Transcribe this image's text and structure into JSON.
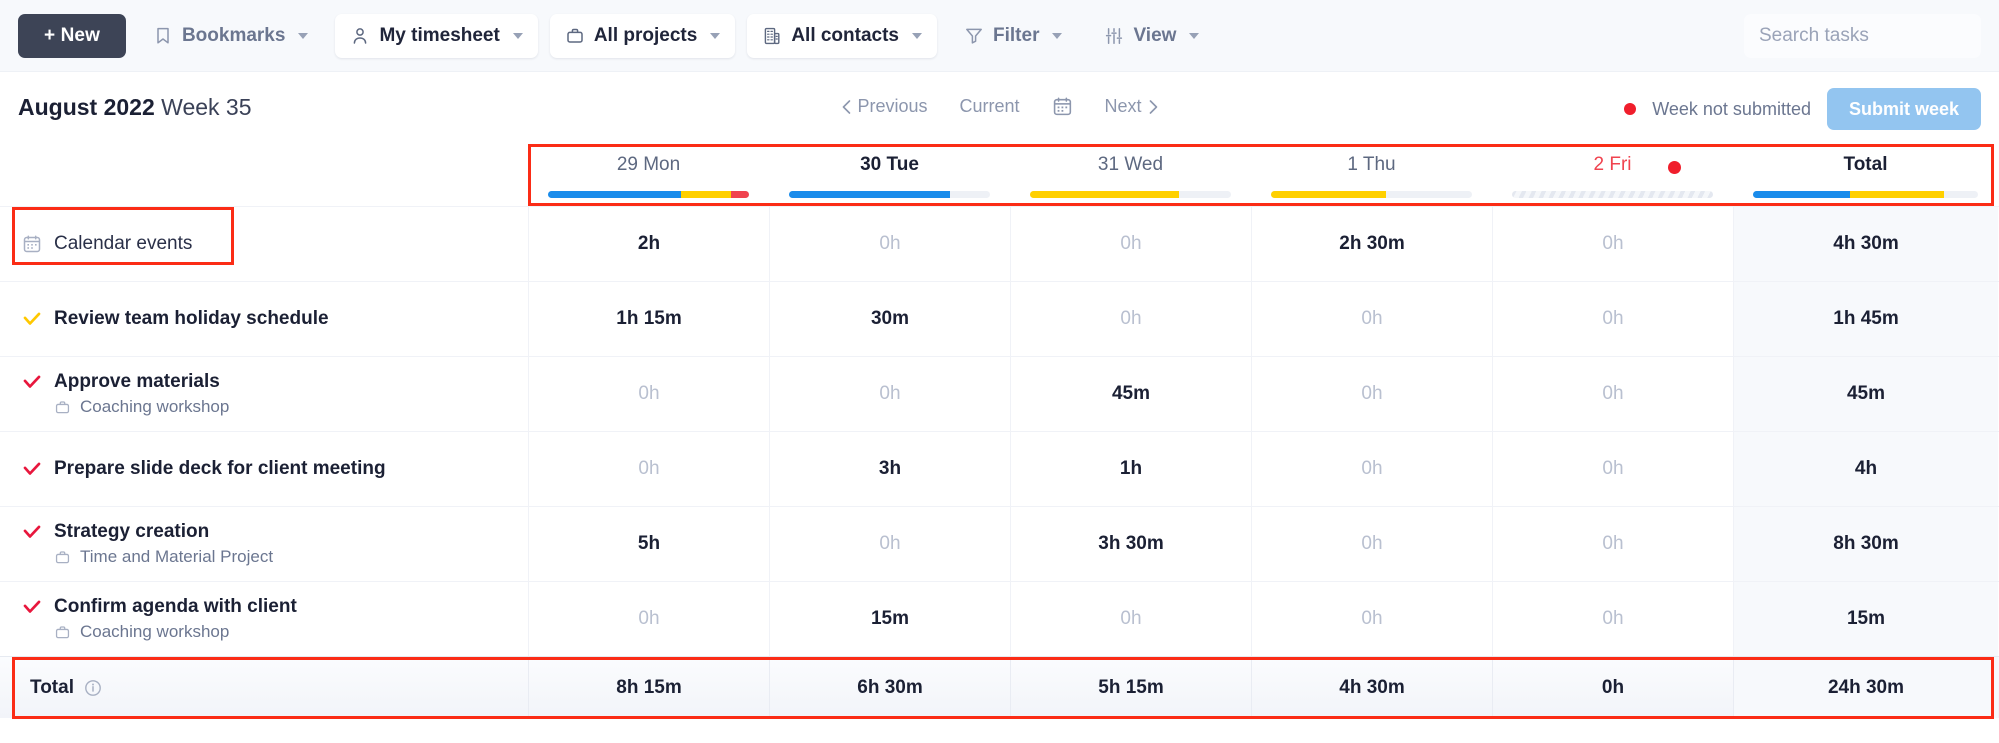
{
  "toolbar": {
    "new_label": "+ New",
    "items": [
      {
        "label": "Bookmarks",
        "icon": "bookmark-icon",
        "boxed": false,
        "caret": true
      },
      {
        "label": "My timesheet",
        "icon": "person-icon",
        "boxed": true,
        "caret": true
      },
      {
        "label": "All projects",
        "icon": "briefcase-icon",
        "boxed": true,
        "caret": true
      },
      {
        "label": "All contacts",
        "icon": "building-icon",
        "boxed": true,
        "caret": true
      },
      {
        "label": "Filter",
        "icon": "funnel-icon",
        "boxed": false,
        "caret": true
      },
      {
        "label": "View",
        "icon": "sliders-icon",
        "boxed": false,
        "caret": true
      }
    ],
    "search_placeholder": "Search tasks"
  },
  "header": {
    "month_year": "August 2022",
    "week": "Week 35",
    "nav": {
      "previous": "Previous",
      "current": "Current",
      "next": "Next",
      "calendar_icon": "calendar-icon"
    },
    "status_text": "Week not submitted",
    "submit_label": "Submit week"
  },
  "columns": [
    {
      "key": "mon",
      "label": "29 Mon",
      "today": false,
      "off": false,
      "bar": [
        {
          "color": "#1a8ceb",
          "pct": 66
        },
        {
          "color": "#ffd000",
          "pct": 25
        },
        {
          "color": "#f0434f",
          "pct": 9
        }
      ]
    },
    {
      "key": "tue",
      "label": "30 Tue",
      "today": true,
      "off": false,
      "bar": [
        {
          "color": "#1a8ceb",
          "pct": 80
        }
      ]
    },
    {
      "key": "wed",
      "label": "31 Wed",
      "today": false,
      "off": false,
      "bar": [
        {
          "color": "#ffd000",
          "pct": 74
        }
      ]
    },
    {
      "key": "thu",
      "label": "1 Thu",
      "today": false,
      "off": false,
      "bar": [
        {
          "color": "#ffd000",
          "pct": 57
        }
      ]
    },
    {
      "key": "fri",
      "label": "2 Fri",
      "today": false,
      "off": true,
      "hatched": true,
      "dot": true,
      "bar": []
    },
    {
      "key": "total",
      "label": "Total",
      "is_total": true,
      "bar": [
        {
          "color": "#1a8ceb",
          "pct": 43
        },
        {
          "color": "#ffd000",
          "pct": 42
        }
      ]
    }
  ],
  "rows": [
    {
      "name": "Calendar events",
      "icon": "calendar-icon",
      "check": null,
      "bold": false,
      "project": null,
      "highlight": true,
      "values": [
        "2h",
        "0h",
        "0h",
        "2h 30m",
        "0h"
      ],
      "total": "4h 30m"
    },
    {
      "name": "Review team holiday schedule",
      "icon": null,
      "check": "#ffc800",
      "bold": true,
      "project": null,
      "values": [
        "1h 15m",
        "30m",
        "0h",
        "0h",
        "0h"
      ],
      "total": "1h 45m"
    },
    {
      "name": "Approve materials",
      "icon": null,
      "check": "#e8173d",
      "bold": true,
      "project": "Coaching workshop",
      "project_icon": "briefcase-icon",
      "values": [
        "0h",
        "0h",
        "45m",
        "0h",
        "0h"
      ],
      "total": "45m"
    },
    {
      "name": "Prepare slide deck for client meeting",
      "icon": null,
      "check": "#e8173d",
      "bold": true,
      "project": null,
      "values": [
        "0h",
        "3h",
        "1h",
        "0h",
        "0h"
      ],
      "total": "4h"
    },
    {
      "name": "Strategy creation",
      "icon": null,
      "check": "#e8173d",
      "bold": true,
      "project": "Time and Material Project",
      "project_icon": "briefcase-icon",
      "values": [
        "5h",
        "0h",
        "3h 30m",
        "0h",
        "0h"
      ],
      "total": "8h 30m"
    },
    {
      "name": "Confirm agenda with client",
      "icon": null,
      "check": "#e8173d",
      "bold": true,
      "project": "Coaching workshop",
      "project_icon": "briefcase-icon",
      "values": [
        "0h",
        "15m",
        "0h",
        "0h",
        "0h"
      ],
      "total": "15m"
    }
  ],
  "total_row": {
    "label": "Total",
    "info_icon": "info-icon",
    "values": [
      "8h 15m",
      "6h 30m",
      "5h 15m",
      "4h 30m",
      "0h"
    ],
    "total": "24h 30m"
  },
  "colors": {
    "accent_red": "#e8404f",
    "highlight_box": "#fb2c16",
    "bar_blue": "#1a8ceb",
    "bar_yellow": "#ffd000",
    "bar_red": "#f0434f",
    "submit_blue": "#93c5f0",
    "new_dark": "#3d4456"
  }
}
